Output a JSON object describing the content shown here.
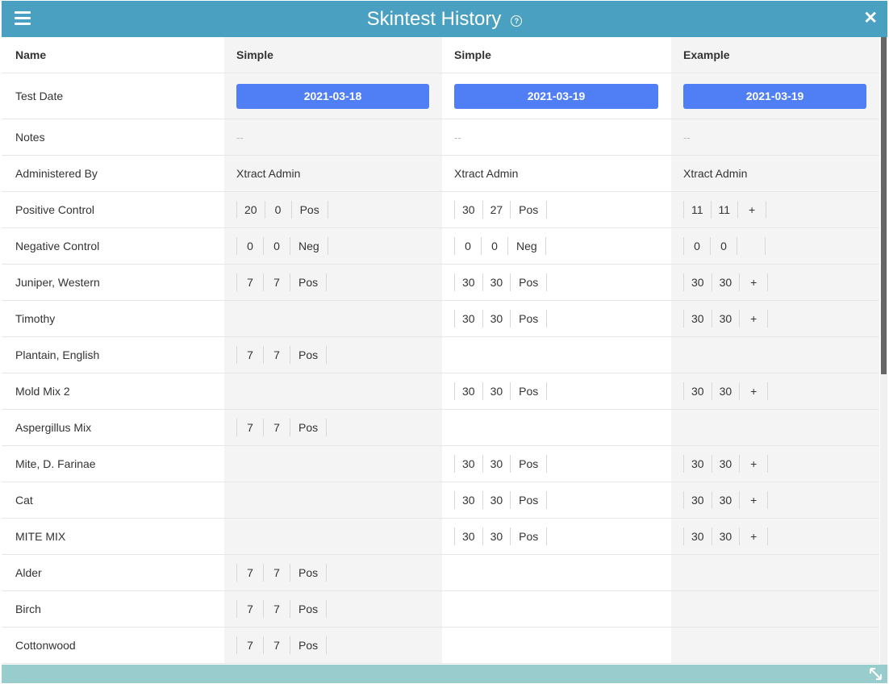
{
  "window": {
    "title": "Skintest History",
    "help_icon": "?",
    "close_icon": "✕"
  },
  "colors": {
    "titlebar": "#4aa0c0",
    "date_button": "#4f7ef5",
    "footer": "#99cdcd",
    "shade": "#f4f4f4"
  },
  "table": {
    "name_label": "Name",
    "columns": [
      "Simple",
      "Simple",
      "Example"
    ],
    "test_date_label": "Test Date",
    "test_dates": [
      "2021-03-18",
      "2021-03-19",
      "2021-03-19"
    ],
    "notes_label": "Notes",
    "notes": [
      "--",
      "--",
      "--"
    ],
    "administered_label": "Administered By",
    "administered": [
      "Xtract Admin",
      "Xtract Admin",
      "Xtract Admin"
    ],
    "rows": [
      {
        "label": "Positive Control",
        "cells": [
          [
            "20",
            "0",
            "Pos"
          ],
          [
            "30",
            "27",
            "Pos"
          ],
          [
            "11",
            "11",
            "+"
          ]
        ]
      },
      {
        "label": "Negative Control",
        "cells": [
          [
            "0",
            "0",
            "Neg"
          ],
          [
            "0",
            "0",
            "Neg"
          ],
          [
            "0",
            "0",
            ""
          ]
        ]
      },
      {
        "label": "Juniper, Western",
        "cells": [
          [
            "7",
            "7",
            "Pos"
          ],
          [
            "30",
            "30",
            "Pos"
          ],
          [
            "30",
            "30",
            "+"
          ]
        ]
      },
      {
        "label": "Timothy",
        "cells": [
          null,
          [
            "30",
            "30",
            "Pos"
          ],
          [
            "30",
            "30",
            "+"
          ]
        ]
      },
      {
        "label": "Plantain, English",
        "cells": [
          [
            "7",
            "7",
            "Pos"
          ],
          null,
          null
        ]
      },
      {
        "label": "Mold Mix 2",
        "cells": [
          null,
          [
            "30",
            "30",
            "Pos"
          ],
          [
            "30",
            "30",
            "+"
          ]
        ]
      },
      {
        "label": "Aspergillus Mix",
        "cells": [
          [
            "7",
            "7",
            "Pos"
          ],
          null,
          null
        ]
      },
      {
        "label": "Mite, D. Farinae",
        "cells": [
          null,
          [
            "30",
            "30",
            "Pos"
          ],
          [
            "30",
            "30",
            "+"
          ]
        ]
      },
      {
        "label": "Cat",
        "cells": [
          null,
          [
            "30",
            "30",
            "Pos"
          ],
          [
            "30",
            "30",
            "+"
          ]
        ]
      },
      {
        "label": "MITE MIX",
        "cells": [
          null,
          [
            "30",
            "30",
            "Pos"
          ],
          [
            "30",
            "30",
            "+"
          ]
        ]
      },
      {
        "label": "Alder",
        "cells": [
          [
            "7",
            "7",
            "Pos"
          ],
          null,
          null
        ]
      },
      {
        "label": "Birch",
        "cells": [
          [
            "7",
            "7",
            "Pos"
          ],
          null,
          null
        ]
      },
      {
        "label": "Cottonwood",
        "cells": [
          [
            "7",
            "7",
            "Pos"
          ],
          null,
          null
        ]
      }
    ]
  }
}
